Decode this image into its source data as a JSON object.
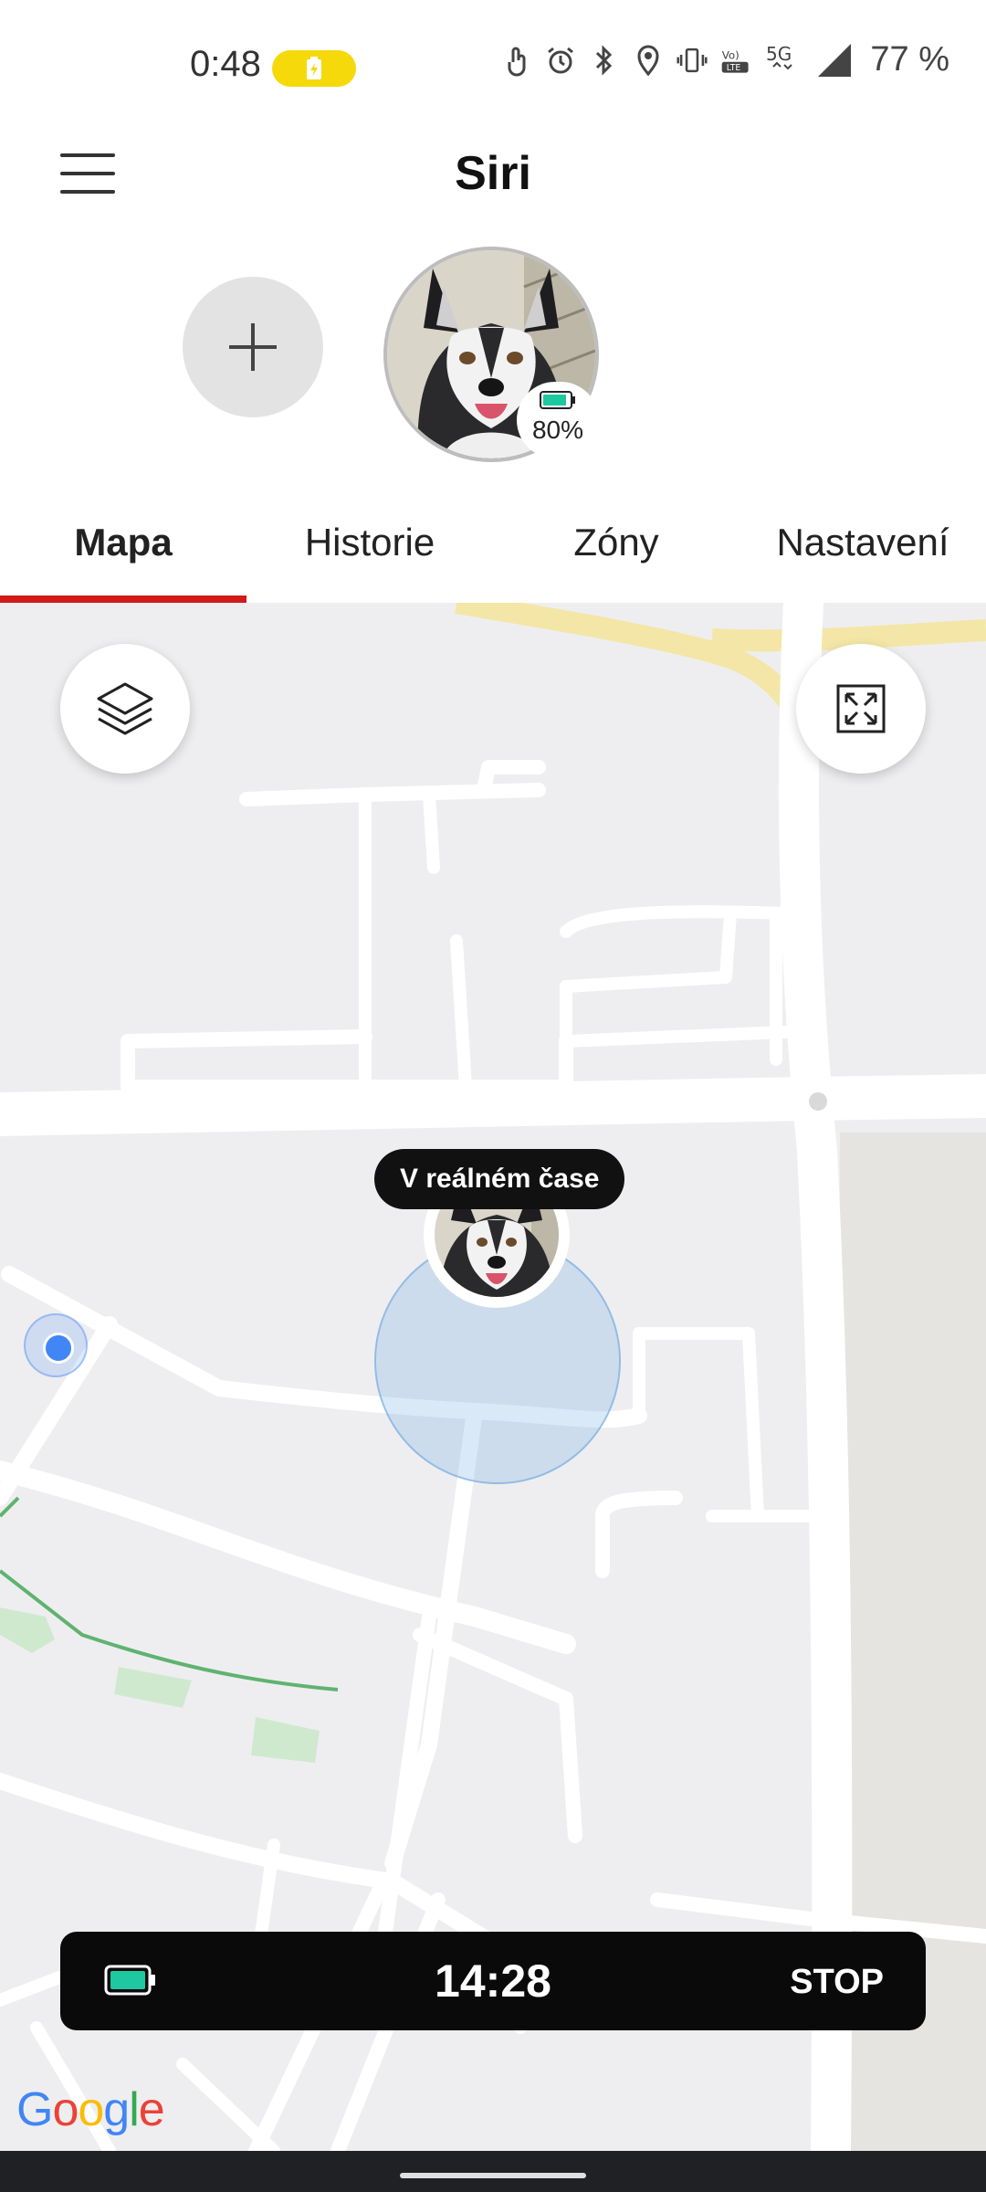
{
  "status_bar": {
    "time": "0:48",
    "battery_percent": "77 %",
    "network": "5G",
    "volte": "VoLTE"
  },
  "header": {
    "title": "Siri",
    "menu_icon": "hamburger-menu-icon"
  },
  "pets": {
    "add_icon": "plus-icon",
    "selected": {
      "name": "Siri",
      "battery_label": "80%",
      "battery_level": 0.8
    }
  },
  "tabs": [
    {
      "label": "Mapa",
      "active": true
    },
    {
      "label": "Historie",
      "active": false
    },
    {
      "label": "Zóny",
      "active": false
    },
    {
      "label": "Nastavení",
      "active": false
    }
  ],
  "map": {
    "layers_icon": "layers-icon",
    "fullscreen_icon": "expand-icon",
    "realtime_label": "V reálném čase",
    "attribution": "Google"
  },
  "tracking": {
    "timer": "14:28",
    "stop_label": "STOP",
    "battery_icon": "battery-icon"
  },
  "colors": {
    "accent": "#d21a1a",
    "battery_green": "#1ec8a0",
    "charge_pill": "#f5d90a"
  }
}
